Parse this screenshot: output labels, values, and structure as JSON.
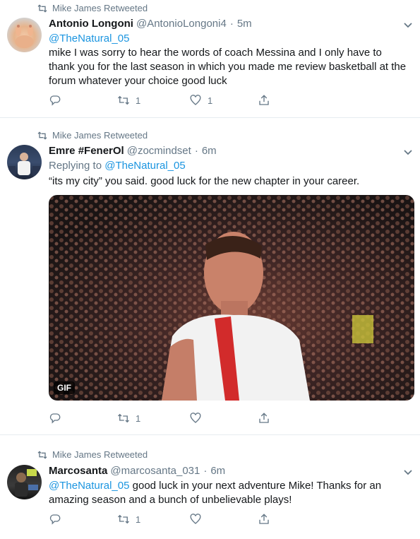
{
  "tweets": [
    {
      "retweeted_by": "Mike James Retweeted",
      "name": "Antonio Longoni",
      "handle": "@AntonioLongoni4",
      "time": "5m",
      "mention": "@TheNatural_05",
      "text": "mike I was sorry to hear the words of coach Messina and I only have to thank you for the last season in which you made me review basketball at the forum whatever your choice good luck",
      "retweets": "1",
      "likes": "1"
    },
    {
      "retweeted_by": "Mike James Retweeted",
      "name": "Emre #FenerOl",
      "handle": "@zocmindset",
      "time": "6m",
      "replying_to_label": "Replying to",
      "replying_to_handle": "@TheNatural_05",
      "text": "“its my city” you said. good luck for the new chapter in your career.",
      "media_badge": "GIF",
      "retweets": "1",
      "likes": ""
    },
    {
      "retweeted_by": "Mike James Retweeted",
      "name": "Marcosanta",
      "handle": "@marcosanta_031",
      "time": "6m",
      "mention": "@TheNatural_05",
      "text": "good luck in your next adventure Mike! Thanks for an amazing season and a bunch of unbelievable plays!",
      "retweets": "1",
      "likes": ""
    }
  ],
  "dot": "·",
  "icons": [
    "retweet-icon",
    "chevron-down-icon",
    "reply-icon",
    "heart-icon",
    "share-icon"
  ],
  "colors": {
    "link": "#1b95e0",
    "muted": "#657786",
    "border": "#e6ecf0",
    "text": "#14171a"
  }
}
